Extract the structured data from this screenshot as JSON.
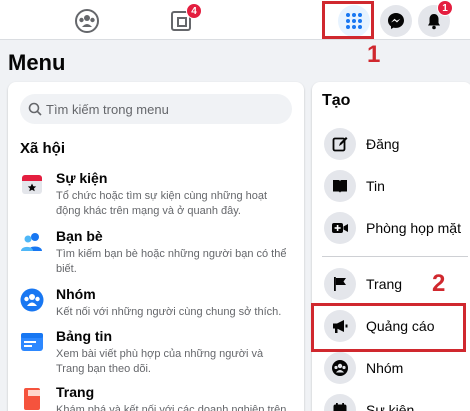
{
  "topbar": {
    "groups_badge": "4",
    "notifications_badge": "1"
  },
  "annotations": {
    "step1": "1",
    "step2": "2"
  },
  "menu": {
    "title": "Menu",
    "search_placeholder": "Tìm kiếm trong menu",
    "section_social": "Xã hội",
    "items": [
      {
        "title": "Sự kiện",
        "desc": "Tổ chức hoặc tìm sự kiện cùng những hoạt động khác trên mạng và ở quanh đây."
      },
      {
        "title": "Bạn bè",
        "desc": "Tìm kiếm bạn bè hoặc những người bạn có thể biết."
      },
      {
        "title": "Nhóm",
        "desc": "Kết nối với những người cùng chung sở thích."
      },
      {
        "title": "Bảng tin",
        "desc": "Xem bài viết phù hợp của những người và Trang bạn theo dõi."
      },
      {
        "title": "Trang",
        "desc": "Khám phá và kết nối với các doanh nghiệp trên"
      }
    ]
  },
  "create": {
    "title": "Tạo",
    "items": [
      {
        "label": "Đăng"
      },
      {
        "label": "Tin"
      },
      {
        "label": "Phòng họp mặt"
      },
      {
        "label": "Trang"
      },
      {
        "label": "Quảng cáo"
      },
      {
        "label": "Nhóm"
      },
      {
        "label": "Sự kiện"
      }
    ]
  },
  "colors": {
    "accent_red": "#d0282e",
    "fb_blue": "#1877f2",
    "badge_red": "#e41e3f"
  }
}
